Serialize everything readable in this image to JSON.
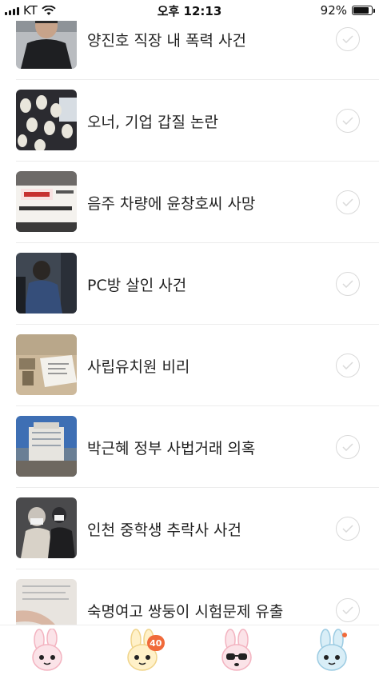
{
  "status_bar": {
    "carrier": "KT",
    "time": "오후 12:13",
    "battery": "92%",
    "battery_level": 0.92
  },
  "items": [
    {
      "title": "양진호 직장 내 폭력 사건",
      "thumb": "jacket-man-photo"
    },
    {
      "title": "오너, 기업 갑질 논란",
      "thumb": "protest-masks-photo"
    },
    {
      "title": "음주 차량에 윤창호씨 사망",
      "thumb": "banner-protest-photo"
    },
    {
      "title": "PC방 살인 사건",
      "thumb": "suspect-escort-photo"
    },
    {
      "title": "사립유치원 비리",
      "thumb": "classroom-documents-photo"
    },
    {
      "title": "박근혜 정부 사법거래 의혹",
      "thumb": "court-building-photo"
    },
    {
      "title": "인천 중학생 추락사 사건",
      "thumb": "masked-suspects-photo"
    },
    {
      "title": "숙명여고 쌍둥이 시험문제 유출",
      "thumb": "exam-paper-photo"
    }
  ],
  "tabbar": {
    "tabs": [
      {
        "icon": "bunny-pink-icon",
        "accent": "#f6b9c4"
      },
      {
        "icon": "bunny-yellow-icon",
        "accent": "#f7dd8c",
        "badge": "40"
      },
      {
        "icon": "bunny-sunglasses-icon",
        "accent": "#f6b9c4"
      },
      {
        "icon": "bunny-blue-icon",
        "accent": "#a9d6ec"
      }
    ]
  },
  "colors": {
    "badge": "#f06a3a",
    "divider": "#ececec",
    "check_border": "#d9d9d9"
  }
}
